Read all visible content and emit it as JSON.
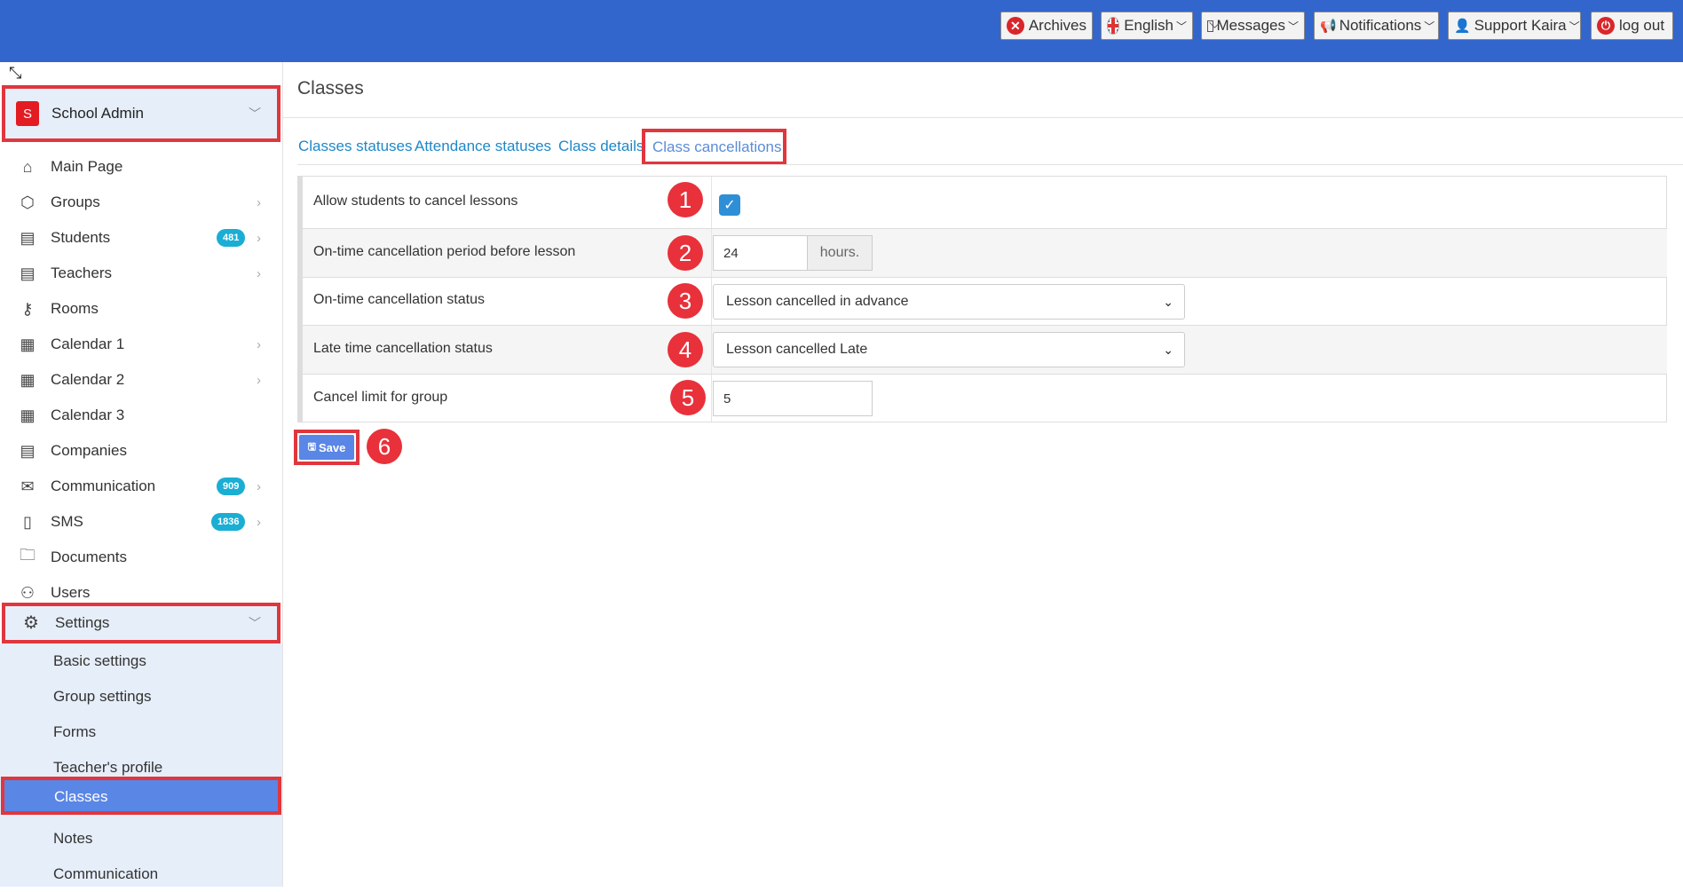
{
  "topbar": {
    "archives": "Archives",
    "language": "English",
    "messages": "Messages",
    "notifications": "Notifications",
    "user": "Support Kaira",
    "logout": "log out"
  },
  "sidebar": {
    "school_badge": "S",
    "school_name": "School Admin",
    "items": [
      {
        "label": "Main Page",
        "icon": "home-icon"
      },
      {
        "label": "Groups",
        "icon": "cube-icon"
      },
      {
        "label": "Students",
        "icon": "id-card-icon",
        "count": "481"
      },
      {
        "label": "Teachers",
        "icon": "id-card-icon"
      },
      {
        "label": "Rooms",
        "icon": "key-icon"
      },
      {
        "label": "Calendar 1",
        "icon": "calendar-icon"
      },
      {
        "label": "Calendar 2",
        "icon": "calendar-icon"
      },
      {
        "label": "Calendar 3",
        "icon": "calendar-icon"
      },
      {
        "label": "Companies",
        "icon": "id-card-icon"
      },
      {
        "label": "Communication",
        "icon": "envelope-icon",
        "count": "909"
      },
      {
        "label": "SMS",
        "icon": "mobile-icon",
        "count": "1836"
      },
      {
        "label": "Documents",
        "icon": "folder-icon"
      },
      {
        "label": "Users",
        "icon": "user-icon"
      }
    ],
    "settings": "Settings",
    "submenu": [
      "Basic settings",
      "Group settings",
      "Forms",
      "Teacher's profile",
      "Classes",
      "Notes",
      "Communication"
    ]
  },
  "main": {
    "title": "Classes",
    "tabs": [
      "Classes statuses",
      "Attendance statuses",
      "Class details",
      "Class cancellations"
    ],
    "rows": [
      {
        "label": "Allow students to cancel lessons",
        "marker": "1",
        "checked": true
      },
      {
        "label": "On-time cancellation period before lesson",
        "marker": "2",
        "value": "24",
        "addon": "hours."
      },
      {
        "label": "On-time cancellation status",
        "marker": "3",
        "value": "Lesson cancelled in advance"
      },
      {
        "label": "Late time cancellation status",
        "marker": "4",
        "value": "Lesson cancelled Late"
      },
      {
        "label": "Cancel limit for group",
        "marker": "5",
        "value": "5"
      }
    ],
    "save_label": "Save",
    "save_marker": "6"
  },
  "colors": {
    "topbar": "#3366cc",
    "highlight": "#e0363e",
    "accent": "#5a86e6",
    "link": "#1e88c8"
  }
}
